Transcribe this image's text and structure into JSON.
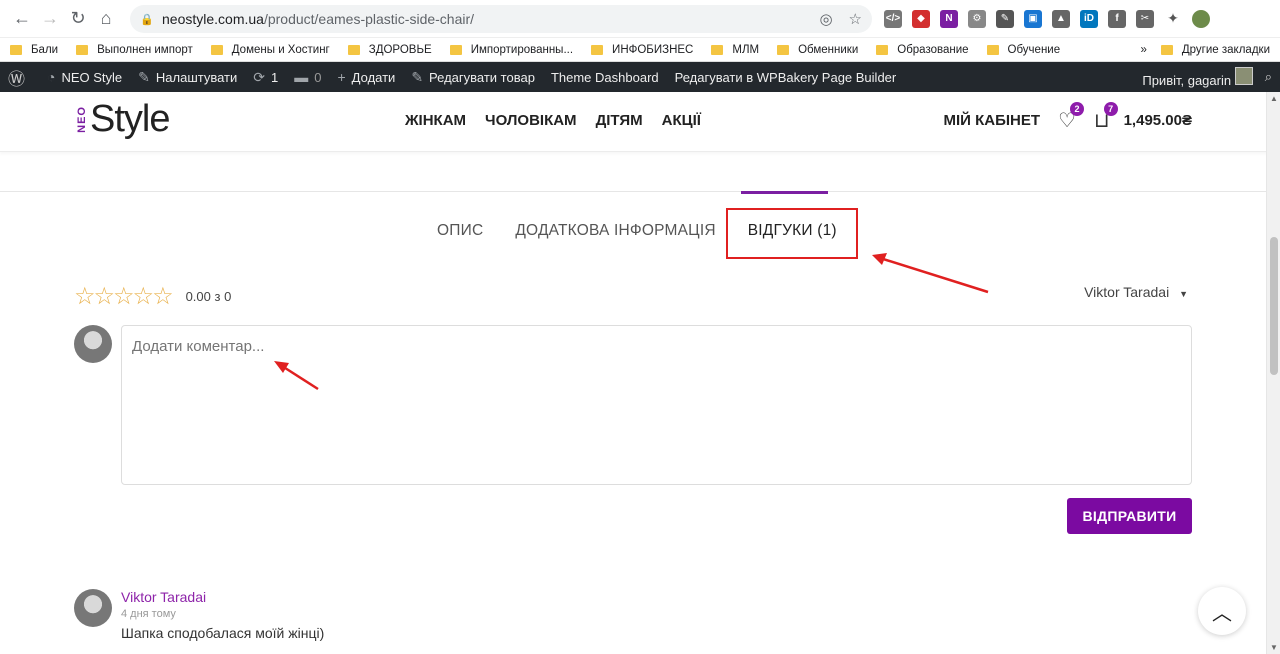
{
  "browser": {
    "url_domain": "neostyle.com.ua",
    "url_path": "/product/eames-plastic-side-chair/",
    "bookmarks": [
      "Бали",
      "Выполнен импорт",
      "Домены и Хостинг",
      "ЗДОРОВЬЕ",
      "Импортированны...",
      "ИНФОБИЗНЕС",
      "МЛМ",
      "Обменники",
      "Образование",
      "Обучение"
    ],
    "more_bookmarks": "»",
    "other_bookmarks": "Другие закладки"
  },
  "wp_admin_bar": {
    "site_name": "NEO Style",
    "customize": "Налаштувати",
    "updates_count": "1",
    "comments_count": "0",
    "add_new": "Додати",
    "edit_product": "Редагувати товар",
    "theme_dashboard": "Theme Dashboard",
    "edit_wpbakery": "Редагувати в WPBakery Page Builder",
    "greeting": "Привіт, gagarin"
  },
  "header": {
    "logo_neo": "NEO",
    "logo_style": "Style",
    "nav": [
      "ЖІНКАМ",
      "ЧОЛОВІКАМ",
      "ДІТЯМ",
      "АКЦІЇ"
    ],
    "account": "МІЙ КАБІНЕТ",
    "wishlist_count": "2",
    "cart_count": "7",
    "cart_total": "1,495.00₴"
  },
  "tabs": {
    "description": "ОПИС",
    "additional_info": "ДОДАТКОВА ІНФОРМАЦІЯ",
    "reviews": "ВІДГУКИ (1)"
  },
  "reviews_section": {
    "rating_text": "0.00 з 0",
    "stars": "☆☆☆☆☆",
    "sort_user": "Viktor Taradai",
    "comment_placeholder": "Додати коментар...",
    "submit_label": "ВІДПРАВИТИ"
  },
  "review": {
    "author": "Viktor Taradai",
    "date": "4 дня тому",
    "text": "Шапка сподобалася моїй жінці)"
  },
  "colors": {
    "accent": "#7b0aa1",
    "highlight_box": "#e02020",
    "star": "#e9b24e"
  }
}
